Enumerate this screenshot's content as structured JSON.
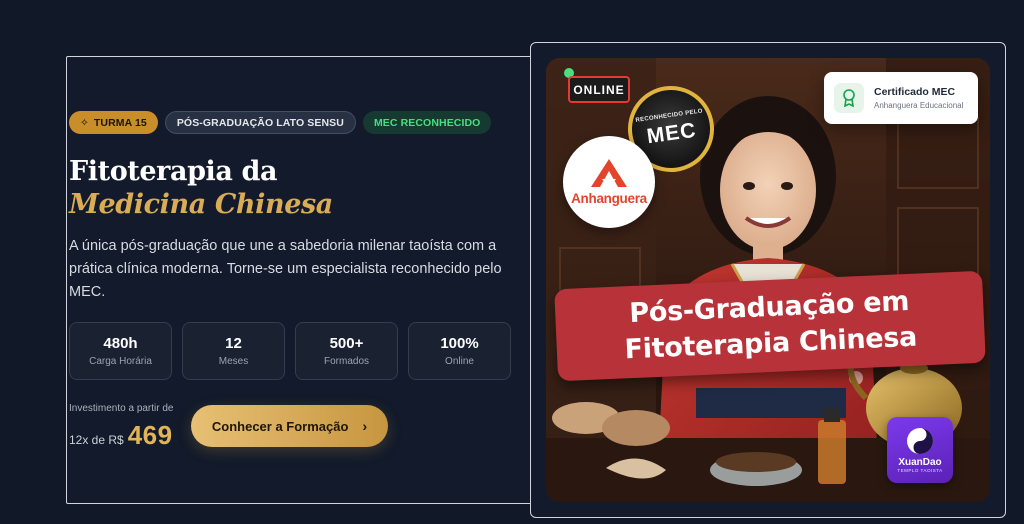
{
  "badges": {
    "turma": {
      "icon": "sparkle-icon",
      "label": "TURMA 15"
    },
    "pos": "PÓS-GRADUAÇÃO LATO SENSU",
    "mec": "MEC RECONHECIDO"
  },
  "title": {
    "line1": "Fitoterapia da",
    "line2": "Medicina Chinesa"
  },
  "description": "A única pós-graduação que une a sabedoria milenar taoísta com a prática clínica moderna. Torne-se um especialista reconhecido pelo MEC.",
  "stats": [
    {
      "value": "480h",
      "label": "Carga Horária"
    },
    {
      "value": "12",
      "label": "Meses"
    },
    {
      "value": "500+",
      "label": "Formados"
    },
    {
      "value": "100%",
      "label": "Online"
    }
  ],
  "investment": {
    "label": "Investimento a partir de",
    "prefix": "12x de R$",
    "value": "469"
  },
  "cta": {
    "label": "Conhecer a Formação",
    "icon": "chevron-right-icon"
  },
  "image": {
    "online_sign": "ONLINE",
    "anhanguera": "Anhanguera",
    "mec_seal": {
      "small": "RECONHECIDO PELO",
      "big": "MEC"
    },
    "cert_card": {
      "title": "Certificado MEC",
      "subtitle": "Anhanguera Educacional",
      "icon": "award-icon"
    },
    "banner": {
      "line1": "Pós-Graduação em",
      "line2": "Fitoterapia Chinesa"
    },
    "xuandao": {
      "name": "XuanDao",
      "sub": "TEMPLO TAOISTA"
    }
  },
  "colors": {
    "background": "#111827",
    "accent_gold": "#d9ac55",
    "badge_orange": "#c98d2a",
    "mec_green": "#4ade80",
    "banner_red": "#b8323a"
  }
}
